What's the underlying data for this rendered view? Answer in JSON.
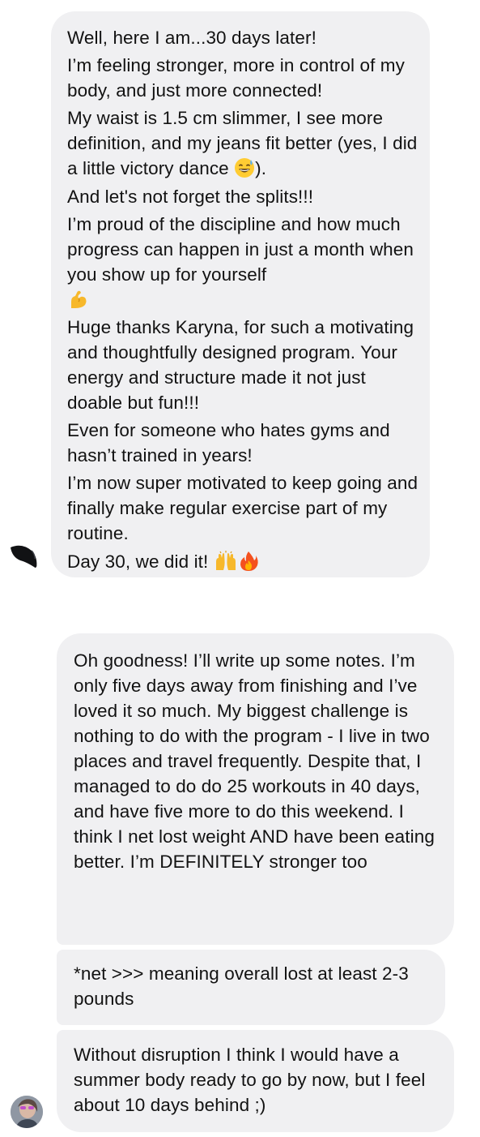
{
  "conversation": {
    "first_message": {
      "paragraphs": [
        "Well, here I am...30 days later!",
        "I’m feeling stronger, more in control of my body, and just more connected!",
        "My waist is 1.5 cm slimmer, I see more definition, and my jeans fit better (yes, I did a little victory dance",
        "And let's not forget the splits!!!",
        "I’m proud of the discipline and how much progress can happen in just a month when you show up for yourself",
        "Huge thanks Karyna, for such a motivating and thoughtfully designed program. Your energy and structure made it not just doable but fun!!!",
        "Even for someone who hates gyms and hasn’t trained in years!",
        "I’m now super motivated to keep going and finally make regular exercise part of my routine.",
        "Day 30, we did it!"
      ],
      "dance_suffix": ").",
      "emojis": {
        "dance": "grinning-sweat-emoji",
        "muscle": "flexed-biceps-emoji",
        "raised_hands": "raising-hands-emoji",
        "fire": "fire-emoji"
      }
    },
    "second_sender_messages": [
      "Oh goodness! I’ll write up some notes. I’m only five days away from finishing and I’ve loved it so much. My biggest challenge is nothing to do with the program - I live in two places and travel frequently. Despite that, I managed to do do 25 workouts in 40 days, and have five more to do this weekend. I think I net lost weight AND have been eating better. I’m DEFINITELY stronger too",
      "*net >>> meaning overall lost at least 2-3 pounds",
      "Without disruption I think I would have a summer body ready to go by now, but I feel about 10 days behind ;)"
    ]
  },
  "colors": {
    "bubble_background": "#f0f0f2",
    "text": "#121212",
    "page_background": "#ffffff"
  }
}
